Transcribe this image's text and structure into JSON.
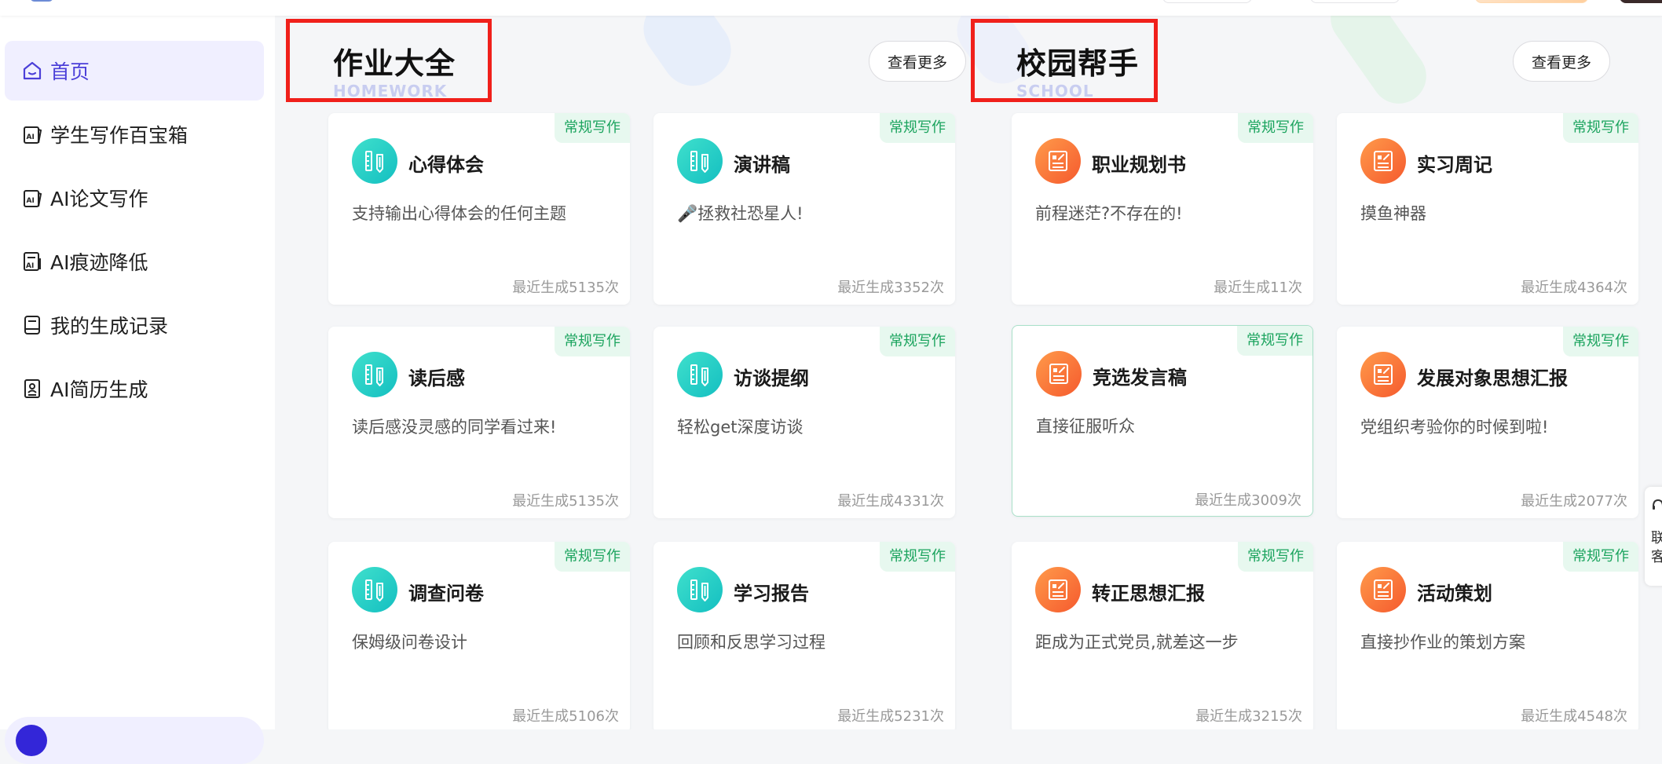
{
  "sidebar": {
    "items": [
      {
        "label": "首页",
        "icon": "home-icon",
        "active": true
      },
      {
        "label": "学生写作百宝箱",
        "icon": "ai-book-icon"
      },
      {
        "label": "AI论文写作",
        "icon": "ai-paper-icon"
      },
      {
        "label": "AI痕迹降低",
        "icon": "ai-reduce-icon"
      },
      {
        "label": "我的生成记录",
        "icon": "history-icon"
      },
      {
        "label": "AI简历生成",
        "icon": "resume-icon"
      }
    ]
  },
  "sections": [
    {
      "title": "作业大全",
      "subtitle": "HOMEWORK",
      "more_label": "查看更多",
      "icon_color": "teal",
      "cards": [
        {
          "title": "心得体会",
          "desc": "支持输出心得体会的任何主题",
          "badge": "常规写作",
          "count": "最近生成5135次"
        },
        {
          "title": "演讲稿",
          "desc": "🎤拯救社恐星人!",
          "badge": "常规写作",
          "count": "最近生成3352次"
        },
        {
          "title": "读后感",
          "desc": "读后感没灵感的同学看过来!",
          "badge": "常规写作",
          "count": "最近生成5135次"
        },
        {
          "title": "访谈提纲",
          "desc": "轻松get深度访谈",
          "badge": "常规写作",
          "count": "最近生成4331次"
        },
        {
          "title": "调查问卷",
          "desc": "保姆级问卷设计",
          "badge": "常规写作",
          "count": "最近生成5106次"
        },
        {
          "title": "学习报告",
          "desc": "回顾和反思学习过程",
          "badge": "常规写作",
          "count": "最近生成5231次"
        }
      ]
    },
    {
      "title": "校园帮手",
      "subtitle": "SCHOOL",
      "more_label": "查看更多",
      "icon_color": "orange",
      "cards": [
        {
          "title": "职业规划书",
          "desc": "前程迷茫?不存在的!",
          "badge": "常规写作",
          "count": "最近生成11次"
        },
        {
          "title": "实习周记",
          "desc": "摸鱼神器",
          "badge": "常规写作",
          "count": "最近生成4364次"
        },
        {
          "title": "竞选发言稿",
          "desc": "直接征服听众",
          "badge": "常规写作",
          "count": "最近生成3009次"
        },
        {
          "title": "发展对象思想汇报",
          "desc": "党组织考验你的时候到啦!",
          "badge": "常规写作",
          "count": "最近生成2077次"
        },
        {
          "title": "转正思想汇报",
          "desc": "距成为正式党员,就差这一步",
          "badge": "常规写作",
          "count": "最近生成3215次"
        },
        {
          "title": "活动策划",
          "desc": "直接抄作业的策划方案",
          "badge": "常规写作",
          "count": "最近生成4548次"
        }
      ]
    }
  ],
  "float_tab": {
    "text": "联客"
  },
  "colors": {
    "accent": "#4b3fd8",
    "badge_green": "#1aa35d",
    "highlight_red": "#f0201b",
    "teal": "#14bfc1",
    "orange": "#f55a2e"
  }
}
